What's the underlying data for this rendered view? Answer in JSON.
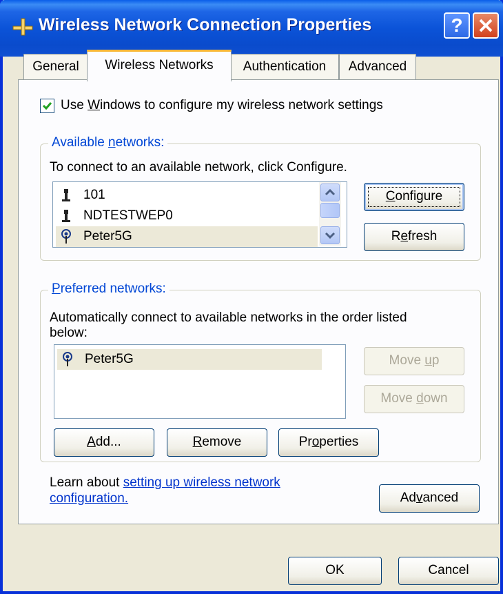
{
  "window": {
    "title": "Wireless Network Connection Properties",
    "help_button": "?",
    "colors": {
      "titlebar": "#0b53d8",
      "dialog_bg": "#ece9d8",
      "tab_accent": "#f8b838",
      "group_title": "#0046d5",
      "link": "#0033cc"
    }
  },
  "tabs": [
    {
      "label": "General",
      "active": false
    },
    {
      "label": "Wireless Networks",
      "active": true
    },
    {
      "label": "Authentication",
      "active": false
    },
    {
      "label": "Advanced",
      "active": false
    }
  ],
  "use_windows": {
    "pre": "Use ",
    "accel": "W",
    "post": "indows to configure my wireless network settings",
    "checked": true
  },
  "available": {
    "title_pre": "Available ",
    "title_accel": "n",
    "title_post": "etworks:",
    "instruction": "To connect to an available network, click Configure.",
    "networks": [
      {
        "name": "101",
        "icon": "ad-hoc-computer-icon",
        "selected": false
      },
      {
        "name": "NDTESTWEP0",
        "icon": "ad-hoc-computer-icon",
        "selected": false
      },
      {
        "name": "Peter5G",
        "icon": "access-point-antenna-icon",
        "selected": true
      }
    ],
    "configure": {
      "accel": "C",
      "rest": "onfigure"
    },
    "refresh": {
      "pre": "R",
      "accel": "e",
      "rest": "fresh"
    }
  },
  "preferred": {
    "title_accel": "P",
    "title_rest": "referred networks:",
    "instruction_line1": "Automatically connect to available networks in the order listed",
    "instruction_line2": "below:",
    "networks": [
      {
        "name": "Peter5G",
        "icon": "access-point-antenna-icon",
        "selected": true
      }
    ],
    "move_up": {
      "pre": "Move ",
      "accel": "u",
      "rest": "p"
    },
    "move_down": {
      "pre": "Move ",
      "accel": "d",
      "rest": "own"
    },
    "add": {
      "accel": "A",
      "rest": "dd..."
    },
    "remove": {
      "accel": "R",
      "rest": "emove"
    },
    "properties": {
      "pre": "Pr",
      "accel": "o",
      "rest": "perties"
    }
  },
  "learn": {
    "text": "Learn about ",
    "link_line1": "setting up wireless network",
    "link_line2": "configuration."
  },
  "advanced_button": {
    "pre": "Ad",
    "accel": "v",
    "rest": "anced"
  },
  "footer": {
    "ok": "OK",
    "cancel": "Cancel"
  }
}
